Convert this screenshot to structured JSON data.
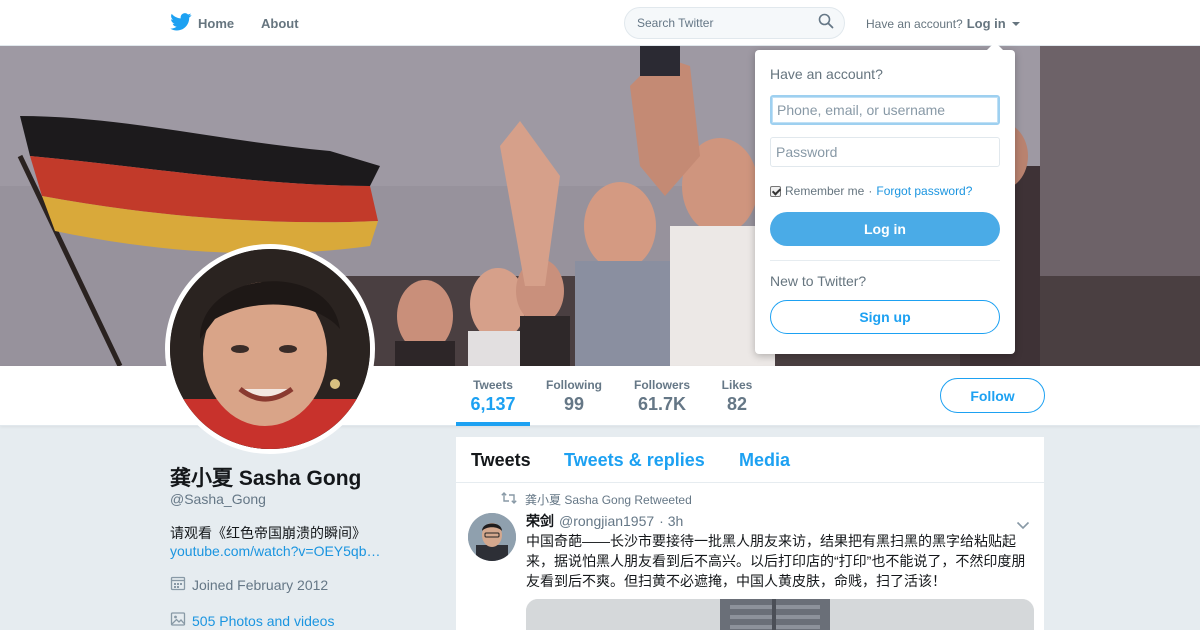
{
  "colors": {
    "brand_blue": "#1da1f2",
    "link_blue": "#1b95e0",
    "muted_gray": "#657786",
    "page_bg": "#e6ecf0"
  },
  "topbar": {
    "logo_icon": "twitter-bird-icon",
    "home_label": "Home",
    "about_label": "About",
    "search_placeholder": "Search Twitter",
    "search_icon": "search-icon",
    "account_prompt": "Have an account?",
    "login_label": "Log in"
  },
  "login_dropdown": {
    "heading": "Have an account?",
    "username_placeholder": "Phone, email, or username",
    "password_placeholder": "Password",
    "remember_label": "Remember me",
    "separator": "·",
    "forgot_label": "Forgot password?",
    "login_button": "Log in",
    "new_prompt": "New to Twitter?",
    "signup_button": "Sign up"
  },
  "profile_nav": {
    "stats": [
      {
        "label": "Tweets",
        "value": "6,137"
      },
      {
        "label": "Following",
        "value": "99"
      },
      {
        "label": "Followers",
        "value": "61.7K"
      },
      {
        "label": "Likes",
        "value": "82"
      }
    ],
    "follow_label": "Follow"
  },
  "profile": {
    "name": "龚小夏 Sasha Gong",
    "handle": "@Sasha_Gong",
    "bio": "请观看《红色帝国崩溃的瞬间》",
    "link": "youtube.com/watch?v=OEY5qb…",
    "joined": "Joined February 2012",
    "photos": "505 Photos and videos"
  },
  "timeline": {
    "tabs": [
      "Tweets",
      "Tweets & replies",
      "Media"
    ],
    "tweet": {
      "retweet_context": "龚小夏 Sasha Gong Retweeted",
      "fullname": "荣剑",
      "username": "@rongjian1957",
      "time": "· 3h",
      "text": "中国奇葩——长沙市要接待一批黑人朋友来访，结果把有黑扫黑的黑字给粘贴起来，据说怕黑人朋友看到后不高兴。以后打印店的“打印”也不能说了，不然印度朋友看到后不爽。但扫黄不必遮掩，中国人黄皮肤，命贱，扫了活该！"
    }
  }
}
